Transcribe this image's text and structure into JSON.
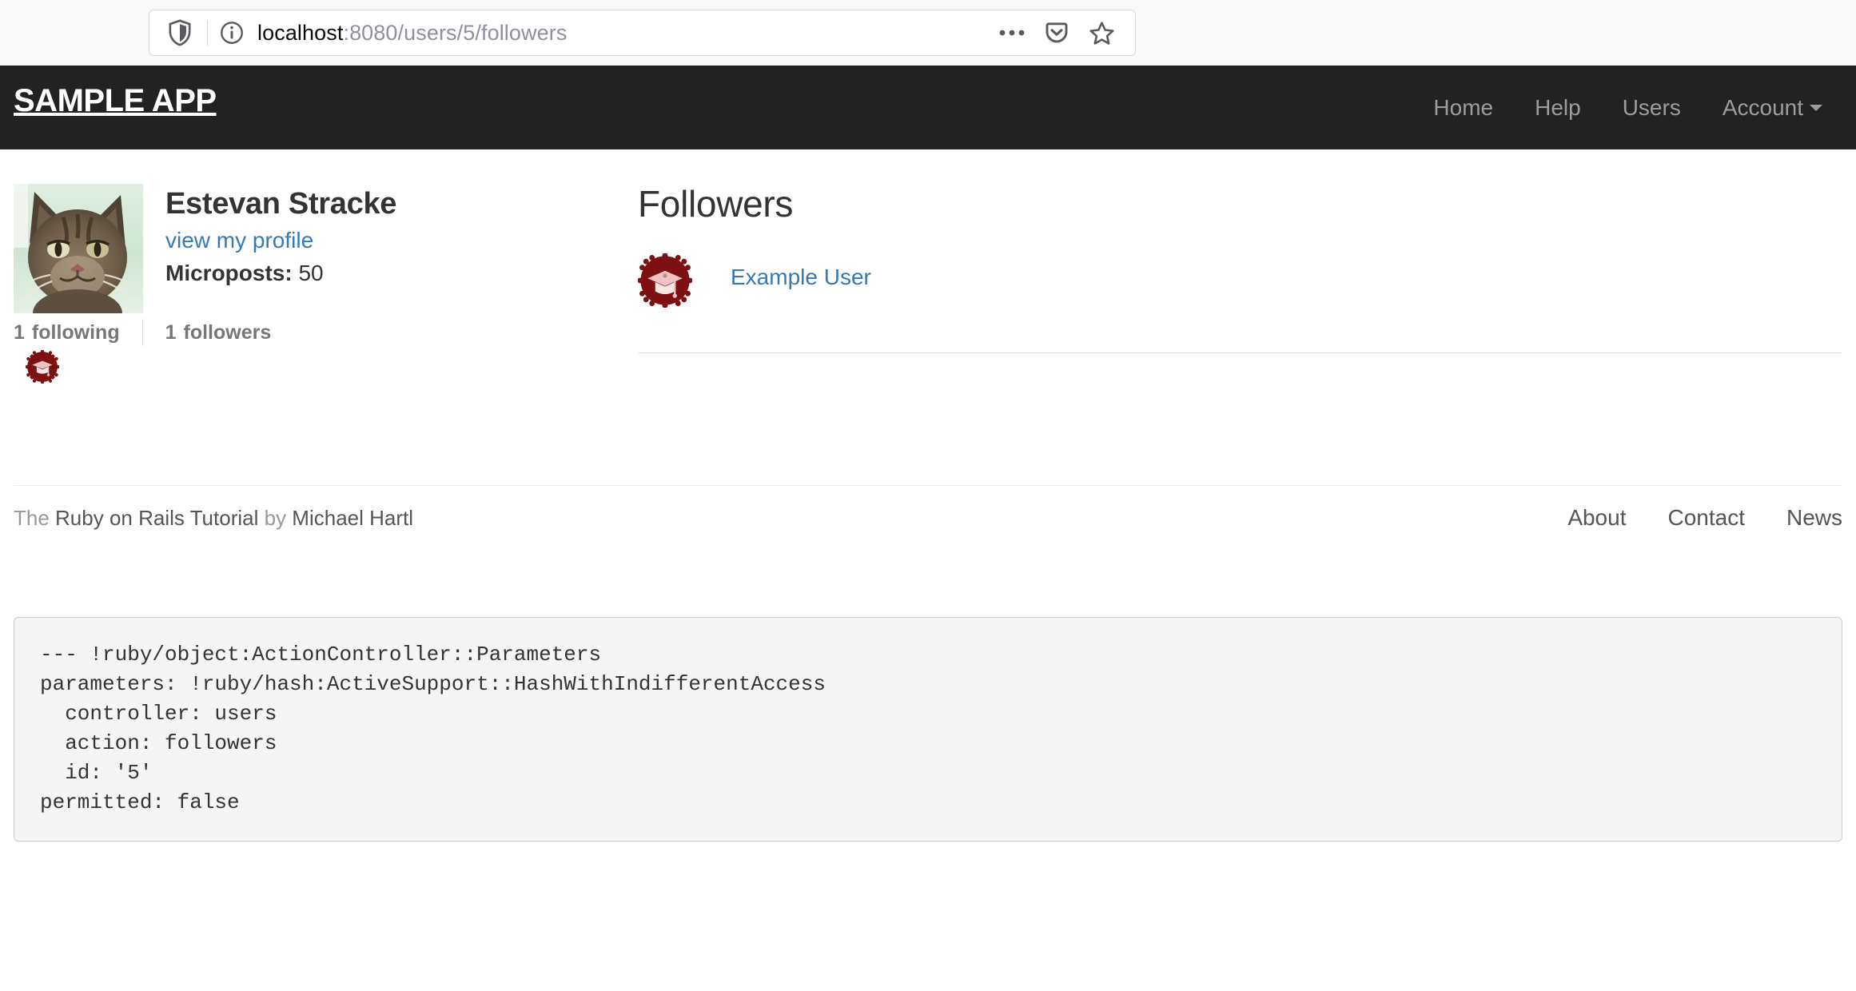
{
  "browser": {
    "url_host": "localhost",
    "url_path": ":8080/users/5/followers",
    "icons": {
      "shield": "shield-icon",
      "info": "info-icon",
      "meatball": "page-actions-icon",
      "pocket": "pocket-icon",
      "star": "bookmark-star-icon"
    }
  },
  "navbar": {
    "logo": "SAMPLE APP",
    "links": [
      {
        "label": "Home"
      },
      {
        "label": "Help"
      },
      {
        "label": "Users"
      },
      {
        "label": "Account",
        "dropdown": true
      }
    ]
  },
  "user": {
    "name": "Estevan Stracke",
    "profile_link": "view my profile",
    "microposts_label": "Microposts:",
    "microposts_count": "50",
    "stats": {
      "following_count": "1",
      "following_label": "following",
      "followers_count": "1",
      "followers_label": "followers"
    }
  },
  "followers": {
    "heading": "Followers",
    "items": [
      {
        "name": "Example User"
      }
    ]
  },
  "footer": {
    "credit_prefix": "The ",
    "credit_link1": "Ruby on Rails Tutorial",
    "credit_middle": " by ",
    "credit_link2": "Michael Hartl",
    "links": [
      {
        "label": "About"
      },
      {
        "label": "Contact"
      },
      {
        "label": "News"
      }
    ]
  },
  "debug": {
    "text": "--- !ruby/object:ActionController::Parameters\nparameters: !ruby/hash:ActiveSupport::HashWithIndifferentAccess\n  controller: users\n  action: followers\n  id: '5'\npermitted: false"
  },
  "colors": {
    "navbar_bg": "#222222",
    "link_blue": "#337ab7",
    "gravatar_red": "#7d1010",
    "muted_gray": "#777777"
  }
}
